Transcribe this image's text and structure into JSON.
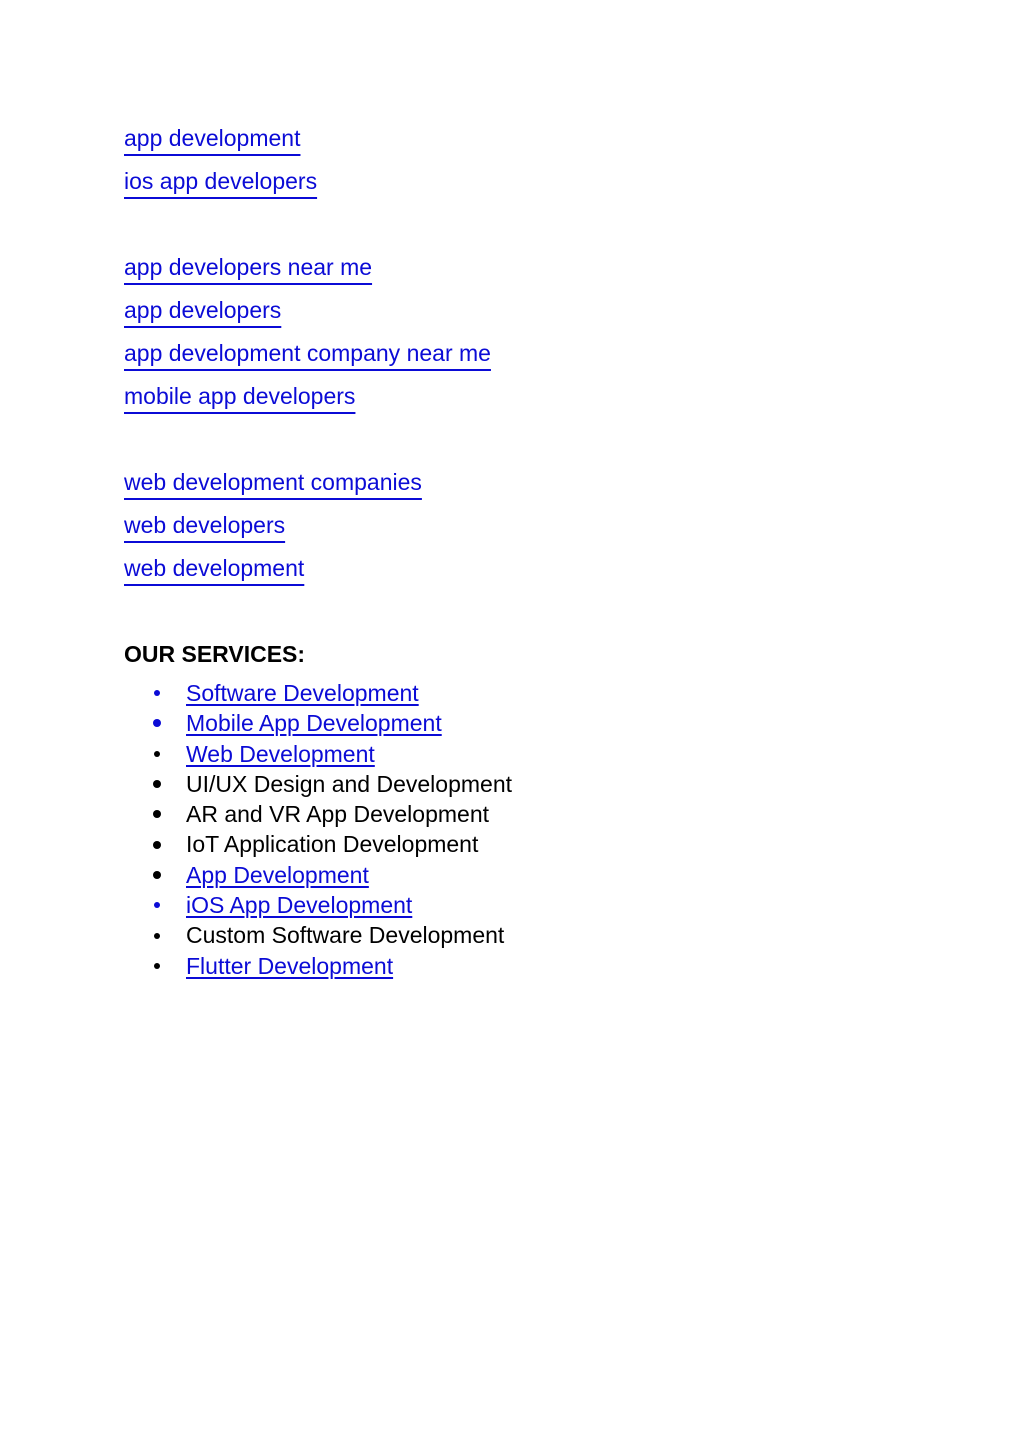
{
  "colors": {
    "link": "#0b0bd6",
    "text": "#000000",
    "background": "#ffffff"
  },
  "keyword_groups": [
    {
      "links": [
        "app development",
        "ios app developers"
      ]
    },
    {
      "links": [
        "app developers near me",
        "app developers",
        "app development company near me",
        "mobile app developers"
      ]
    },
    {
      "links": [
        "web development companies",
        "web developers",
        "web development"
      ]
    }
  ],
  "services": {
    "heading": "OUR SERVICES:",
    "items": [
      {
        "label": "Software Development",
        "is_link": true,
        "bullet_color": "#0b0bd6",
        "bullet_size": "small"
      },
      {
        "label": "Mobile App Development",
        "is_link": true,
        "bullet_color": "#0b0bd6",
        "bullet_size": "large"
      },
      {
        "label": "Web Development",
        "is_link": true,
        "bullet_color": "#000000",
        "bullet_size": "small"
      },
      {
        "label": "UI/UX Design and Development",
        "is_link": false,
        "bullet_color": "#000000",
        "bullet_size": "large"
      },
      {
        "label": "AR and VR App Development",
        "is_link": false,
        "bullet_color": "#000000",
        "bullet_size": "large"
      },
      {
        "label": "IoT Application Development",
        "is_link": false,
        "bullet_color": "#000000",
        "bullet_size": "large"
      },
      {
        "label": "App Development",
        "is_link": true,
        "bullet_color": "#000000",
        "bullet_size": "large"
      },
      {
        "label": "iOS App Development",
        "is_link": true,
        "bullet_color": "#0b0bd6",
        "bullet_size": "small"
      },
      {
        "label": "Custom Software Development",
        "is_link": false,
        "bullet_color": "#000000",
        "bullet_size": "small"
      },
      {
        "label": "Flutter Development",
        "is_link": true,
        "bullet_color": "#000000",
        "bullet_size": "small"
      }
    ]
  }
}
